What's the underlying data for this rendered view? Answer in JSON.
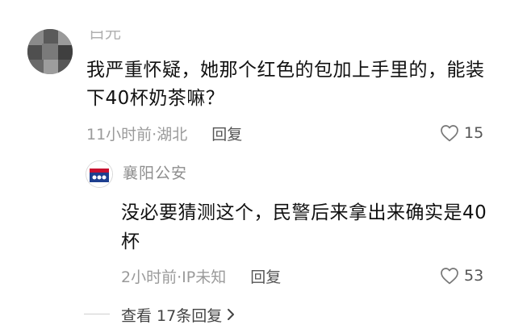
{
  "main_comment": {
    "username": "白光",
    "text": "我严重怀疑，她那个红色的包加上手里的，能装下40杯奶茶嘛？",
    "time_location": "11小时前·湖北",
    "reply_label": "回复",
    "like_icon": "heart-outline-icon",
    "like_count": "15"
  },
  "reply": {
    "username": "襄阳公安",
    "text": "没必要猜测这个，民警后来拿出来确实是40杯",
    "time_location": "2小时前·IP未知",
    "reply_label": "回复",
    "like_icon": "heart-outline-icon",
    "like_count": "53"
  },
  "expand": {
    "label": "查看 17条回复",
    "icon": "chevron-right-icon"
  }
}
